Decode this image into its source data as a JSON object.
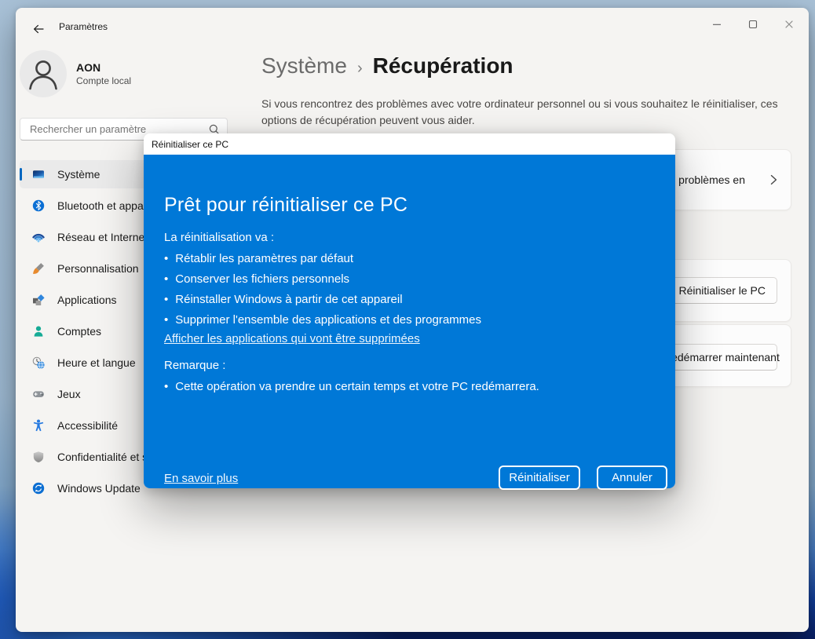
{
  "titlebar": {
    "app_title": "Paramètres"
  },
  "account": {
    "name": "AON",
    "type": "Compte local"
  },
  "search": {
    "placeholder": "Rechercher un paramètre"
  },
  "sidebar": {
    "items": [
      {
        "label": "Système",
        "icon": "system-icon",
        "selected": true
      },
      {
        "label": "Bluetooth et appareils",
        "icon": "bluetooth-icon"
      },
      {
        "label": "Réseau et Internet",
        "icon": "network-icon"
      },
      {
        "label": "Personnalisation",
        "icon": "personalization-icon"
      },
      {
        "label": "Applications",
        "icon": "apps-icon"
      },
      {
        "label": "Comptes",
        "icon": "accounts-icon"
      },
      {
        "label": "Heure et langue",
        "icon": "time-language-icon"
      },
      {
        "label": "Jeux",
        "icon": "games-icon"
      },
      {
        "label": "Accessibilité",
        "icon": "accessibility-icon"
      },
      {
        "label": "Confidentialité et sécurité",
        "icon": "privacy-icon"
      },
      {
        "label": "Windows Update",
        "icon": "windows-update-icon"
      }
    ]
  },
  "header": {
    "breadcrumb_parent": "Système",
    "breadcrumb_separator": "›",
    "page_title": "Récupération",
    "description": "Si vous rencontrez des problèmes avec votre ordinateur personnel ou si vous souhaitez le réinitialiser, ces options de récupération peuvent vous aider."
  },
  "content_cards": {
    "troubleshoot": {
      "visible_text": "problèmes en"
    },
    "reset": {
      "button_label": "Réinitialiser le PC"
    },
    "restart": {
      "button_label": "Redémarrer maintenant"
    }
  },
  "dialog": {
    "titlebar": "Réinitialiser ce PC",
    "heading": "Prêt pour réinitialiser ce PC",
    "intro": "La réinitialisation va :",
    "bullets": [
      "Rétablir les paramètres par défaut",
      "Conserver les fichiers personnels",
      "Réinstaller Windows à partir de cet appareil",
      "Supprimer l'ensemble des applications et des programmes"
    ],
    "apps_link": "Afficher les applications qui vont être supprimées",
    "remark_label": "Remarque :",
    "remark_bullet": "Cette opération va prendre un certain temps et votre PC redémarrera.",
    "learn_more": "En savoir plus",
    "reset_button": "Réinitialiser",
    "cancel_button": "Annuler"
  },
  "colors": {
    "dialog_blue": "#0078d7",
    "accent": "#0067c0",
    "window_background": "#f5f4f2"
  }
}
